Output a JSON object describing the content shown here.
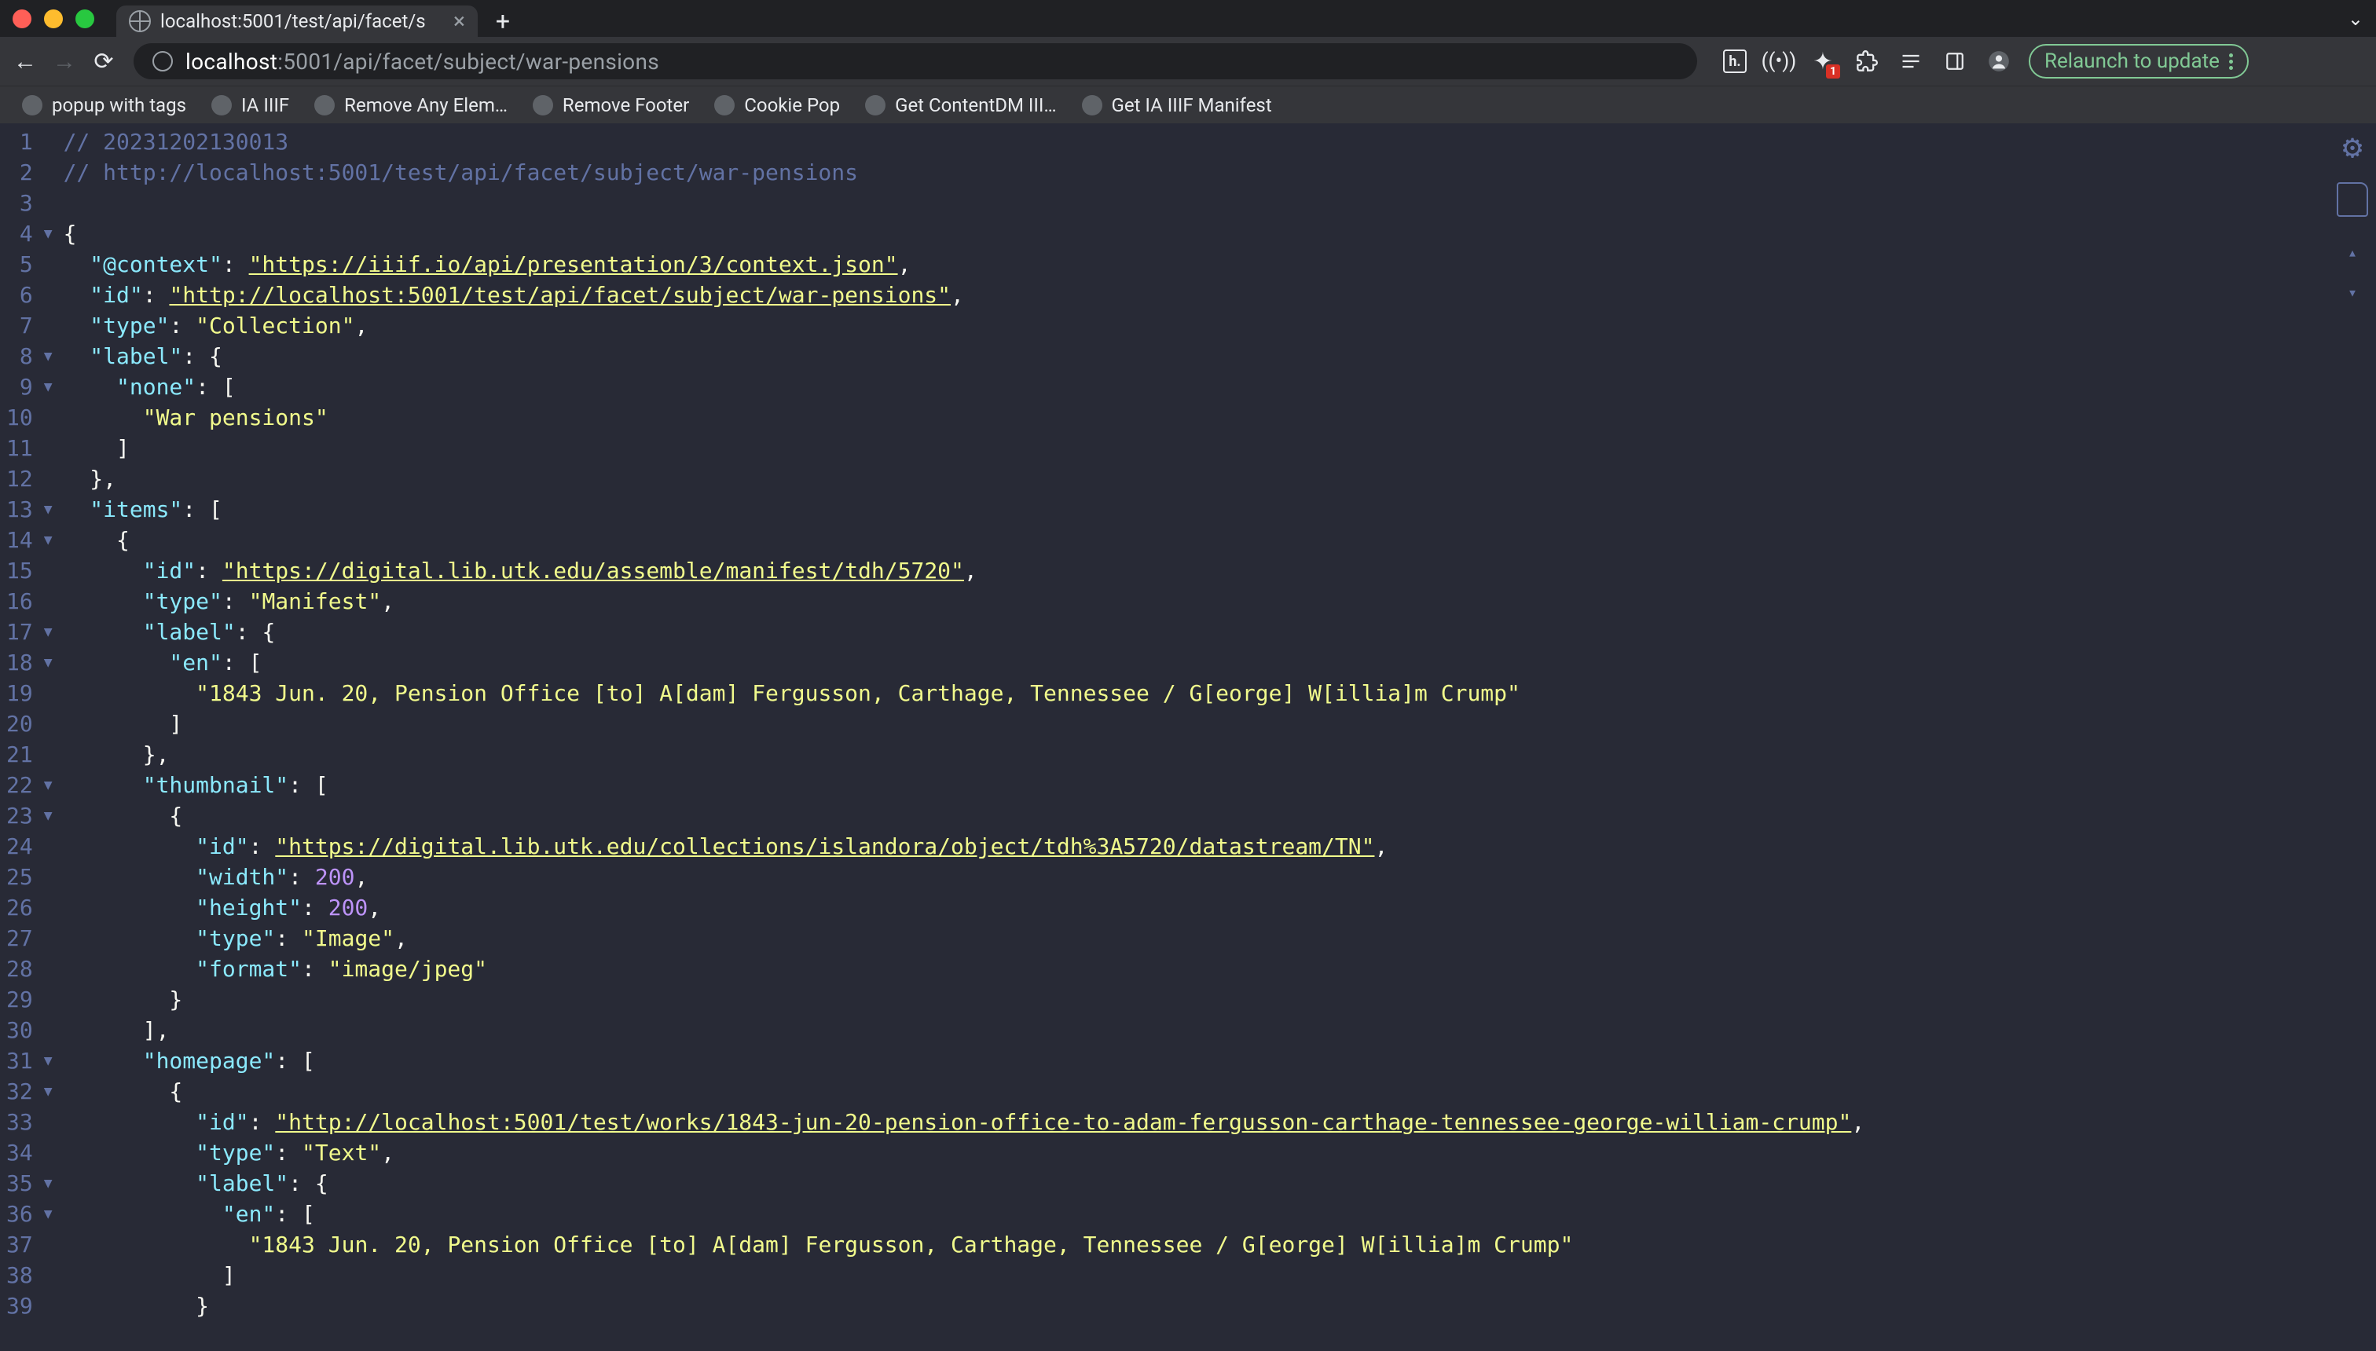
{
  "browser": {
    "tab_title": "localhost:5001/test/api/facet/s",
    "url_host": "localhost",
    "url_port": ":5001",
    "url_path": "/api/facet/subject/war-pensions",
    "relaunch_label": "Relaunch to update",
    "ext_badge": "1",
    "ext_h_label": "h."
  },
  "bookmarks": [
    "popup with tags",
    "IA IIIF",
    "Remove Any Elem…",
    "Remove Footer",
    "Cookie Pop",
    "Get ContentDM III…",
    "Get IA IIIF Manifest"
  ],
  "code": {
    "line_count": 39,
    "fold_markers": {
      "4": "▼",
      "8": "▼",
      "9": "▼",
      "13": "▼",
      "14": "▼",
      "17": "▼",
      "18": "▼",
      "22": "▼",
      "23": "▼",
      "31": "▼",
      "32": "▼",
      "35": "▼",
      "36": "▼"
    },
    "lines": [
      {
        "n": 1,
        "t": "comment",
        "text": "// 20231202130013"
      },
      {
        "n": 2,
        "t": "comment",
        "text": "// http://localhost:5001/test/api/facet/subject/war-pensions"
      },
      {
        "n": 3,
        "t": "blank",
        "text": ""
      },
      {
        "n": 4,
        "t": "punct",
        "text": "{"
      },
      {
        "n": 5,
        "t": "kv",
        "indent": "  ",
        "key": "@context",
        "val": "https://iiif.io/api/presentation/3/context.json",
        "link": true,
        "comma": true
      },
      {
        "n": 6,
        "t": "kv",
        "indent": "  ",
        "key": "id",
        "val": "http://localhost:5001/test/api/facet/subject/war-pensions",
        "link": true,
        "comma": true
      },
      {
        "n": 7,
        "t": "kv",
        "indent": "  ",
        "key": "type",
        "val": "Collection",
        "comma": true
      },
      {
        "n": 8,
        "t": "keyopen",
        "indent": "  ",
        "key": "label",
        "open": "{"
      },
      {
        "n": 9,
        "t": "keyopen",
        "indent": "    ",
        "key": "none",
        "open": "["
      },
      {
        "n": 10,
        "t": "str",
        "indent": "      ",
        "val": "War pensions"
      },
      {
        "n": 11,
        "t": "close",
        "indent": "    ",
        "close": "]"
      },
      {
        "n": 12,
        "t": "close",
        "indent": "  ",
        "close": "},"
      },
      {
        "n": 13,
        "t": "keyopen",
        "indent": "  ",
        "key": "items",
        "open": "["
      },
      {
        "n": 14,
        "t": "punct",
        "indent": "    ",
        "text": "{"
      },
      {
        "n": 15,
        "t": "kv",
        "indent": "      ",
        "key": "id",
        "val": "https://digital.lib.utk.edu/assemble/manifest/tdh/5720",
        "link": true,
        "comma": true
      },
      {
        "n": 16,
        "t": "kv",
        "indent": "      ",
        "key": "type",
        "val": "Manifest",
        "comma": true
      },
      {
        "n": 17,
        "t": "keyopen",
        "indent": "      ",
        "key": "label",
        "open": "{"
      },
      {
        "n": 18,
        "t": "keyopen",
        "indent": "        ",
        "key": "en",
        "open": "["
      },
      {
        "n": 19,
        "t": "str",
        "indent": "          ",
        "val": "1843 Jun. 20, Pension Office [to] A[dam] Fergusson, Carthage, Tennessee / G[eorge] W[illia]m Crump"
      },
      {
        "n": 20,
        "t": "close",
        "indent": "        ",
        "close": "]"
      },
      {
        "n": 21,
        "t": "close",
        "indent": "      ",
        "close": "},"
      },
      {
        "n": 22,
        "t": "keyopen",
        "indent": "      ",
        "key": "thumbnail",
        "open": "["
      },
      {
        "n": 23,
        "t": "punct",
        "indent": "        ",
        "text": "{"
      },
      {
        "n": 24,
        "t": "kv",
        "indent": "          ",
        "key": "id",
        "val": "https://digital.lib.utk.edu/collections/islandora/object/tdh%3A5720/datastream/TN",
        "link": true,
        "comma": true
      },
      {
        "n": 25,
        "t": "kvn",
        "indent": "          ",
        "key": "width",
        "num": 200,
        "comma": true
      },
      {
        "n": 26,
        "t": "kvn",
        "indent": "          ",
        "key": "height",
        "num": 200,
        "comma": true
      },
      {
        "n": 27,
        "t": "kv",
        "indent": "          ",
        "key": "type",
        "val": "Image",
        "comma": true
      },
      {
        "n": 28,
        "t": "kv",
        "indent": "          ",
        "key": "format",
        "val": "image/jpeg"
      },
      {
        "n": 29,
        "t": "close",
        "indent": "        ",
        "close": "}"
      },
      {
        "n": 30,
        "t": "close",
        "indent": "      ",
        "close": "],"
      },
      {
        "n": 31,
        "t": "keyopen",
        "indent": "      ",
        "key": "homepage",
        "open": "["
      },
      {
        "n": 32,
        "t": "punct",
        "indent": "        ",
        "text": "{"
      },
      {
        "n": 33,
        "t": "kv",
        "indent": "          ",
        "key": "id",
        "val": "http://localhost:5001/test/works/1843-jun-20-pension-office-to-adam-fergusson-carthage-tennessee-george-william-crump",
        "link": true,
        "comma": true
      },
      {
        "n": 34,
        "t": "kv",
        "indent": "          ",
        "key": "type",
        "val": "Text",
        "comma": true
      },
      {
        "n": 35,
        "t": "keyopen",
        "indent": "          ",
        "key": "label",
        "open": "{"
      },
      {
        "n": 36,
        "t": "keyopen",
        "indent": "            ",
        "key": "en",
        "open": "["
      },
      {
        "n": 37,
        "t": "str",
        "indent": "              ",
        "val": "1843 Jun. 20, Pension Office [to] A[dam] Fergusson, Carthage, Tennessee / G[eorge] W[illia]m Crump"
      },
      {
        "n": 38,
        "t": "close",
        "indent": "            ",
        "close": "]"
      },
      {
        "n": 39,
        "t": "close",
        "indent": "          ",
        "close": "}"
      }
    ]
  }
}
